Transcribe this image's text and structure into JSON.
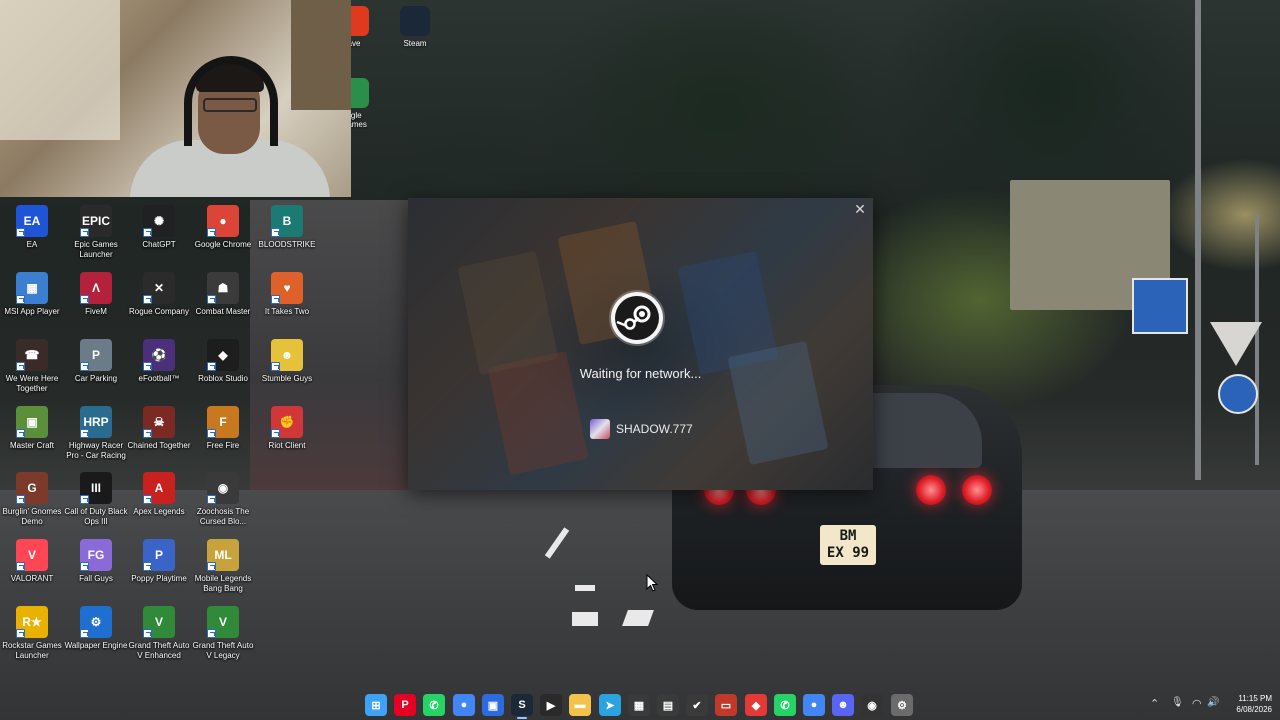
{
  "desktop": {
    "top_icons": [
      {
        "label": "ave",
        "icon": "brave-icon",
        "color": "#e03a1e"
      },
      {
        "label": "Steam",
        "icon": "steam-icon",
        "color": "#1b2838"
      },
      {
        "label": "ogle\nGames",
        "icon": "google-play-games-icon",
        "color": "#2a8f4a"
      }
    ],
    "icons": [
      {
        "label": "EA",
        "icon": "ea-icon",
        "glyph": "EA",
        "color": "#1e55d6"
      },
      {
        "label": "Epic Games Launcher",
        "icon": "epic-games-icon",
        "glyph": "EPIC",
        "color": "#2a2a2a"
      },
      {
        "label": "ChatGPT",
        "icon": "chatgpt-icon",
        "glyph": "✺",
        "color": "#202123"
      },
      {
        "label": "Google Chrome",
        "icon": "chrome-icon",
        "glyph": "●",
        "color": "#db4437"
      },
      {
        "label": "BLOODSTRIKE",
        "icon": "bloodstrike-icon",
        "glyph": "B",
        "color": "#1c7a74"
      },
      {
        "label": "MSI App Player",
        "icon": "msi-app-player-icon",
        "glyph": "▦",
        "color": "#3a7fd0"
      },
      {
        "label": "FiveM",
        "icon": "fivem-icon",
        "glyph": "Λ",
        "color": "#b3223a"
      },
      {
        "label": "Rogue Company",
        "icon": "rogue-company-icon",
        "glyph": "✕",
        "color": "#2b2b2b"
      },
      {
        "label": "Combat Master",
        "icon": "combat-master-icon",
        "glyph": "☗",
        "color": "#3b3b3b"
      },
      {
        "label": "It Takes Two",
        "icon": "it-takes-two-icon",
        "glyph": "♥",
        "color": "#e0602a"
      },
      {
        "label": "We Were Here Together",
        "icon": "we-were-here-icon",
        "glyph": "☎",
        "color": "#3a2a28"
      },
      {
        "label": "Car Parking",
        "icon": "car-parking-icon",
        "glyph": "P",
        "color": "#6b7b8a"
      },
      {
        "label": "eFootball™",
        "icon": "efootball-icon",
        "glyph": "⚽",
        "color": "#4c2f7a"
      },
      {
        "label": "Roblox Studio",
        "icon": "roblox-studio-icon",
        "glyph": "◆",
        "color": "#1d1d1d"
      },
      {
        "label": "Stumble Guys",
        "icon": "stumble-guys-icon",
        "glyph": "☻",
        "color": "#e5c23a"
      },
      {
        "label": "Master Craft",
        "icon": "master-craft-icon",
        "glyph": "▣",
        "color": "#5b8f3a"
      },
      {
        "label": "Highway Racer Pro - Car Racing",
        "icon": "highway-racer-icon",
        "glyph": "HRP",
        "color": "#2a6c8f"
      },
      {
        "label": "Chained Together",
        "icon": "chained-together-icon",
        "glyph": "☠",
        "color": "#7a2a22"
      },
      {
        "label": "Free Fire",
        "icon": "free-fire-icon",
        "glyph": "F",
        "color": "#c8781e"
      },
      {
        "label": "Riot Client",
        "icon": "riot-client-icon",
        "glyph": "✊",
        "color": "#d13639"
      },
      {
        "label": "Burglin' Gnomes Demo",
        "icon": "burglin-gnomes-icon",
        "glyph": "G",
        "color": "#7b3a2a"
      },
      {
        "label": "Call of Duty Black Ops III",
        "icon": "cod-black-ops-icon",
        "glyph": "III",
        "color": "#1a1a1a"
      },
      {
        "label": "Apex Legends",
        "icon": "apex-legends-icon",
        "glyph": "A",
        "color": "#c9211e"
      },
      {
        "label": "Zoochosis The Cursed Blo...",
        "icon": "zoochosis-icon",
        "glyph": "◉",
        "color": "#3a3a3a"
      },
      {
        "label": "",
        "icon": "",
        "glyph": "",
        "color": ""
      },
      {
        "label": "VALORANT",
        "icon": "valorant-icon",
        "glyph": "V",
        "color": "#ff4655"
      },
      {
        "label": "Fall Guys",
        "icon": "fall-guys-icon",
        "glyph": "FG",
        "color": "#8a6ad6"
      },
      {
        "label": "Poppy Playtime",
        "icon": "poppy-playtime-icon",
        "glyph": "P",
        "color": "#3a64c8"
      },
      {
        "label": "Mobile Legends Bang Bang",
        "icon": "mobile-legends-icon",
        "glyph": "ML",
        "color": "#c8a23a"
      },
      {
        "label": "",
        "icon": "",
        "glyph": "",
        "color": ""
      },
      {
        "label": "Rockstar Games Launcher",
        "icon": "rockstar-icon",
        "glyph": "R★",
        "color": "#e9b100"
      },
      {
        "label": "Wallpaper Engine",
        "icon": "wallpaper-engine-icon",
        "glyph": "⚙",
        "color": "#1f6fd1"
      },
      {
        "label": "Grand Theft Auto V Enhanced",
        "icon": "gta-v-enhanced-icon",
        "glyph": "V",
        "color": "#2f8a3a"
      },
      {
        "label": "Grand Theft Auto V Legacy",
        "icon": "gta-v-legacy-icon",
        "glyph": "V",
        "color": "#2f8a3a"
      }
    ]
  },
  "steam_dialog": {
    "status": "Waiting for network...",
    "username": "SHADOW.777",
    "close_glyph": "✕"
  },
  "taskbar": {
    "apps": [
      {
        "name": "start-icon",
        "glyph": "⊞",
        "color": "#3fa2f7"
      },
      {
        "name": "pinterest-icon",
        "glyph": "P",
        "color": "#e60023"
      },
      {
        "name": "whatsapp-icon",
        "glyph": "✆",
        "color": "#25d366"
      },
      {
        "name": "chrome-icon",
        "glyph": "●",
        "color": "#4285f4"
      },
      {
        "name": "store-icon",
        "glyph": "▣",
        "color": "#2d6ae0"
      },
      {
        "name": "steam-icon",
        "glyph": "S",
        "color": "#1b2838"
      },
      {
        "name": "terminal-icon",
        "glyph": "▶",
        "color": "#2a2a2a"
      },
      {
        "name": "file-explorer-icon",
        "glyph": "▬",
        "color": "#f2c24a"
      },
      {
        "name": "telegram-icon",
        "glyph": "➤",
        "color": "#2aa3e0"
      },
      {
        "name": "microsoft-store-icon",
        "glyph": "▦",
        "color": "#3a3a3a"
      },
      {
        "name": "app-green-icon",
        "glyph": "▤",
        "color": "#3a3a3a"
      },
      {
        "name": "check-icon",
        "glyph": "✔",
        "color": "#3a3a3a"
      },
      {
        "name": "archive-icon",
        "glyph": "▭",
        "color": "#c0392b"
      },
      {
        "name": "anydesk-icon",
        "glyph": "◆",
        "color": "#e53935"
      },
      {
        "name": "whatsapp-business-icon",
        "glyph": "✆",
        "color": "#25d366"
      },
      {
        "name": "chrome-alt-icon",
        "glyph": "●",
        "color": "#4285f4"
      },
      {
        "name": "discord-icon",
        "glyph": "☻",
        "color": "#5865f2"
      },
      {
        "name": "obs-icon",
        "glyph": "◉",
        "color": "#333"
      },
      {
        "name": "settings-icon",
        "glyph": "⚙",
        "color": "#6b6b6b"
      }
    ],
    "tray": {
      "chevron": "⌃",
      "mic": "🎙",
      "wifi": "◠",
      "volume": "🔊"
    },
    "clock": {
      "time": "11:15 PM",
      "date": "6/08/2026"
    }
  }
}
